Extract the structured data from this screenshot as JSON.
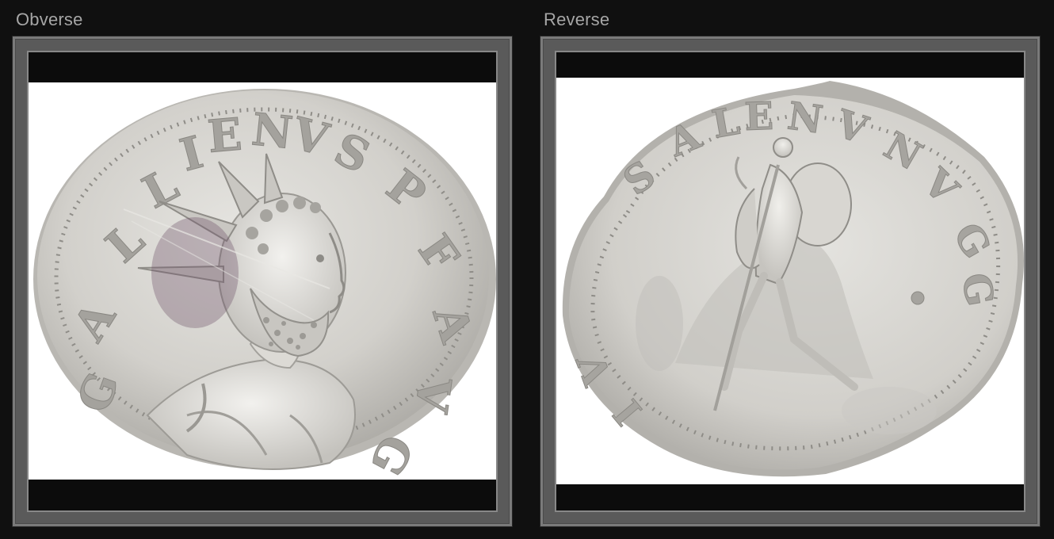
{
  "panels": {
    "obverse": {
      "label": "Obverse",
      "image_alt": "Obverse of silver coin showing radiate bust"
    },
    "reverse": {
      "label": "Reverse",
      "image_alt": "Reverse of silver coin showing standing figure"
    }
  },
  "colors": {
    "background": "#101010",
    "frame": "#5a5a5a",
    "frame_border": "#7a7a7a",
    "coin_silver": "#d3d1cc"
  }
}
